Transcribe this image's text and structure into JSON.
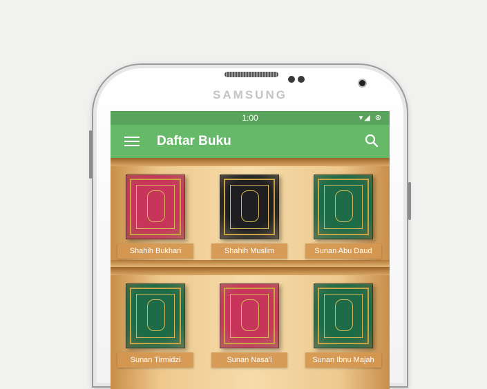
{
  "device": {
    "brand": "SAMSUNG"
  },
  "statusbar": {
    "time": "1:00",
    "icons": "▾◢ ⊛"
  },
  "appbar": {
    "title": "Daftar Buku"
  },
  "books": [
    {
      "title": "Shahih Bukhari",
      "color": "#c8355a"
    },
    {
      "title": "Shahih Muslim",
      "color": "#1f1f22"
    },
    {
      "title": "Sunan Abu Daud",
      "color": "#1d6b47"
    },
    {
      "title": "Sunan Tirmidzi",
      "color": "#1d6b47"
    },
    {
      "title": "Sunan Nasa'i",
      "color": "#c8355a"
    },
    {
      "title": "Sunan Ibnu Majah",
      "color": "#1d6b47"
    }
  ],
  "colors": {
    "primary": "#67b96a",
    "statusbar": "#5aa35c",
    "label": "#d4964f"
  }
}
